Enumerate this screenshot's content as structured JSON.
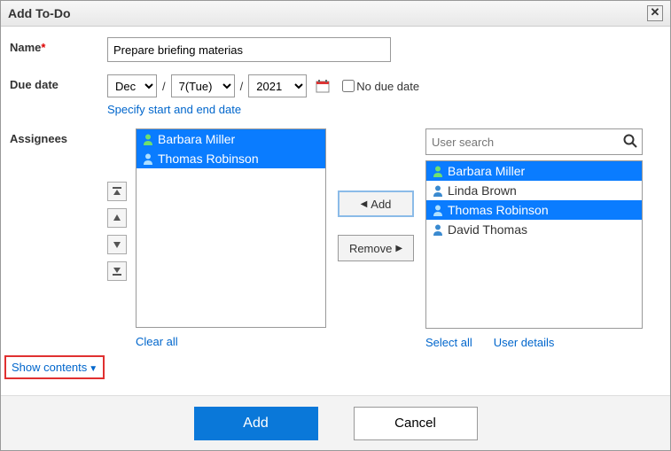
{
  "dialog": {
    "title": "Add To-Do"
  },
  "labels": {
    "name": "Name",
    "due_date": "Due date",
    "assignees": "Assignees",
    "no_due_date": "No due date",
    "specify_dates": "Specify start and end date",
    "clear_all": "Clear all",
    "select_all": "Select all",
    "user_details": "User details",
    "show_contents": "Show contents"
  },
  "name_field": {
    "value": "Prepare briefing materias"
  },
  "date": {
    "month": "Dec",
    "day": "7(Tue)",
    "year": "2021"
  },
  "search": {
    "placeholder": "User search"
  },
  "middle": {
    "add": "Add",
    "remove": "Remove"
  },
  "assignees_left": [
    {
      "name": "Barbara Miller",
      "selected": true,
      "color": "green"
    },
    {
      "name": "Thomas Robinson",
      "selected": true,
      "color": "blue"
    }
  ],
  "assignees_right": [
    {
      "name": "Barbara Miller",
      "selected": true,
      "color": "green"
    },
    {
      "name": "Linda Brown",
      "selected": false,
      "color": "blue"
    },
    {
      "name": "Thomas Robinson",
      "selected": true,
      "color": "blue"
    },
    {
      "name": "David Thomas",
      "selected": false,
      "color": "blue"
    }
  ],
  "footer": {
    "add": "Add",
    "cancel": "Cancel"
  }
}
